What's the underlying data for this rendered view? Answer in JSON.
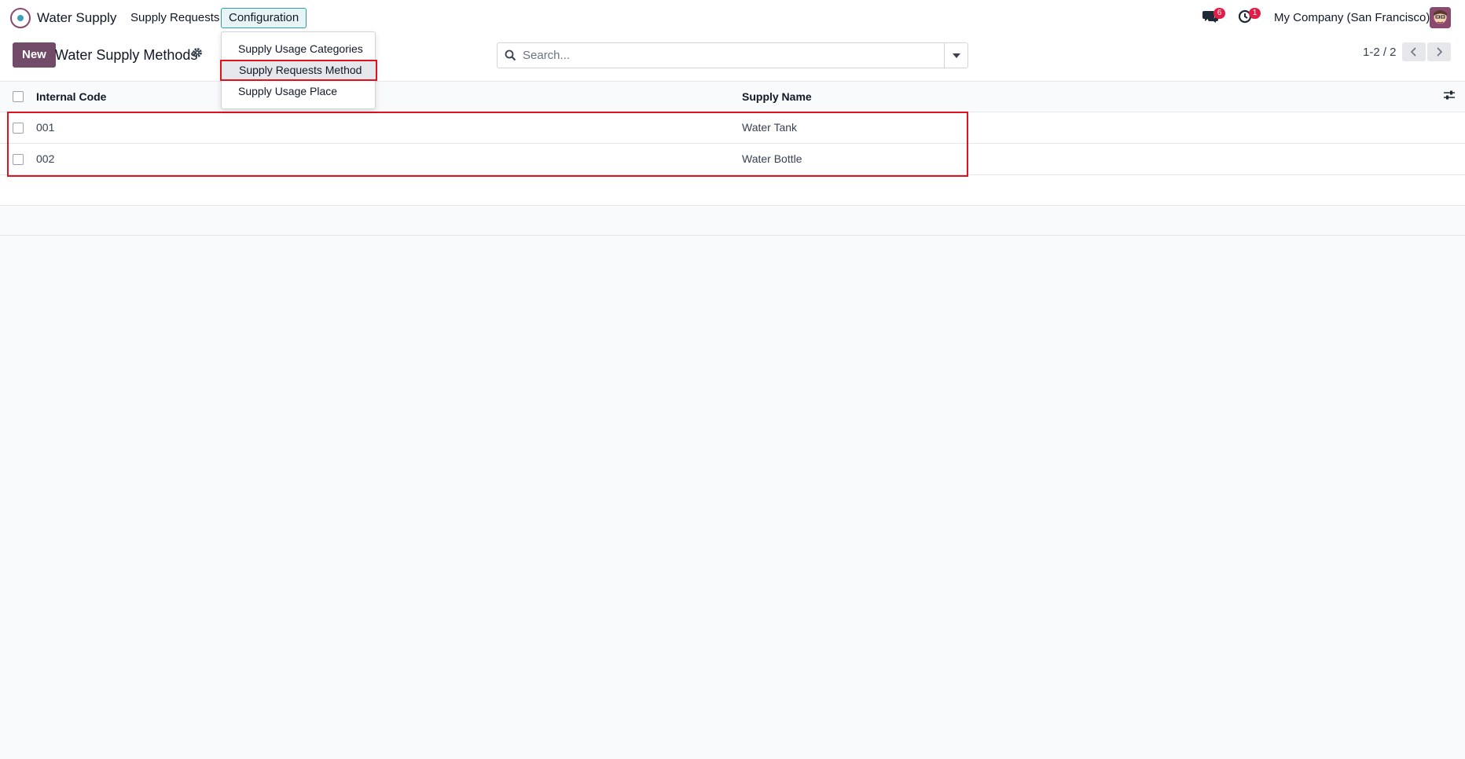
{
  "navbar": {
    "app_name": "Water Supply",
    "menu_supply_requests": "Supply Requests",
    "menu_configuration": "Configuration",
    "chat_badge": "6",
    "activity_badge": "1",
    "company": "My Company (San Francisco)"
  },
  "config_menu": {
    "items": [
      "Supply Usage Categories",
      "Supply Requests Method",
      "Supply Usage Place"
    ],
    "highlighted_index": 1
  },
  "control_panel": {
    "new_label": "New",
    "title": "Water Supply Methods",
    "search_placeholder": "Search...",
    "pager": "1-2 / 2"
  },
  "table": {
    "columns": [
      "Internal Code",
      "Supply Name"
    ],
    "rows": [
      {
        "code": "001",
        "name": "Water Tank"
      },
      {
        "code": "002",
        "name": "Water Bottle"
      }
    ]
  },
  "colors": {
    "brand": "#714b67",
    "highlight": "#e0121f",
    "badge": "#e11d48",
    "config_active": "#2e9ba6"
  },
  "icons": [
    "app-logo-icon",
    "chat-icon",
    "activity-clock-icon",
    "gear-icon",
    "search-icon",
    "caret-down-icon",
    "chevron-left-icon",
    "chevron-right-icon",
    "column-settings-icon"
  ]
}
